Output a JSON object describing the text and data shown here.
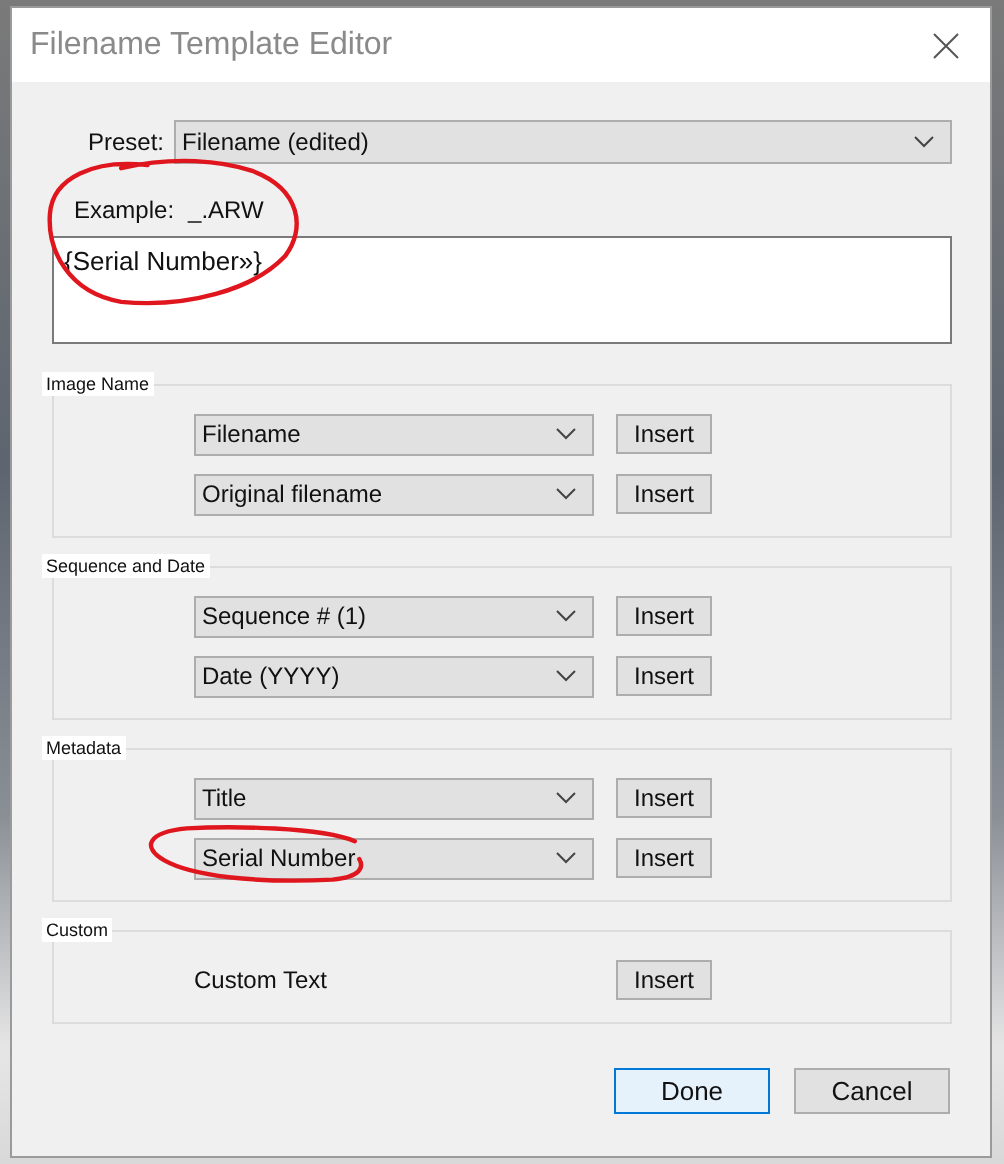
{
  "window": {
    "title": "Filename Template Editor"
  },
  "preset": {
    "label": "Preset:",
    "value": "Filename (edited)"
  },
  "example": {
    "label": "Example:",
    "value": "_.ARW",
    "circled": true
  },
  "template": {
    "value": "{Serial Number»}"
  },
  "groups": [
    {
      "title": "Image Name",
      "rows": [
        {
          "kind": "dropdown",
          "value": "Filename",
          "button": "Insert"
        },
        {
          "kind": "dropdown",
          "value": "Original filename",
          "button": "Insert"
        }
      ]
    },
    {
      "title": "Sequence and Date",
      "rows": [
        {
          "kind": "dropdown",
          "value": "Sequence # (1)",
          "button": "Insert"
        },
        {
          "kind": "dropdown",
          "value": "Date (YYYY)",
          "button": "Insert"
        }
      ]
    },
    {
      "title": "Metadata",
      "rows": [
        {
          "kind": "dropdown",
          "value": "Title",
          "button": "Insert"
        },
        {
          "kind": "dropdown",
          "value": "Serial Number",
          "button": "Insert",
          "circled": true
        }
      ]
    },
    {
      "title": "Custom",
      "rows": [
        {
          "kind": "label",
          "value": "Custom Text",
          "button": "Insert"
        }
      ]
    }
  ],
  "buttons": [
    {
      "label": "Done",
      "default": true
    },
    {
      "label": "Cancel",
      "default": false
    }
  ]
}
